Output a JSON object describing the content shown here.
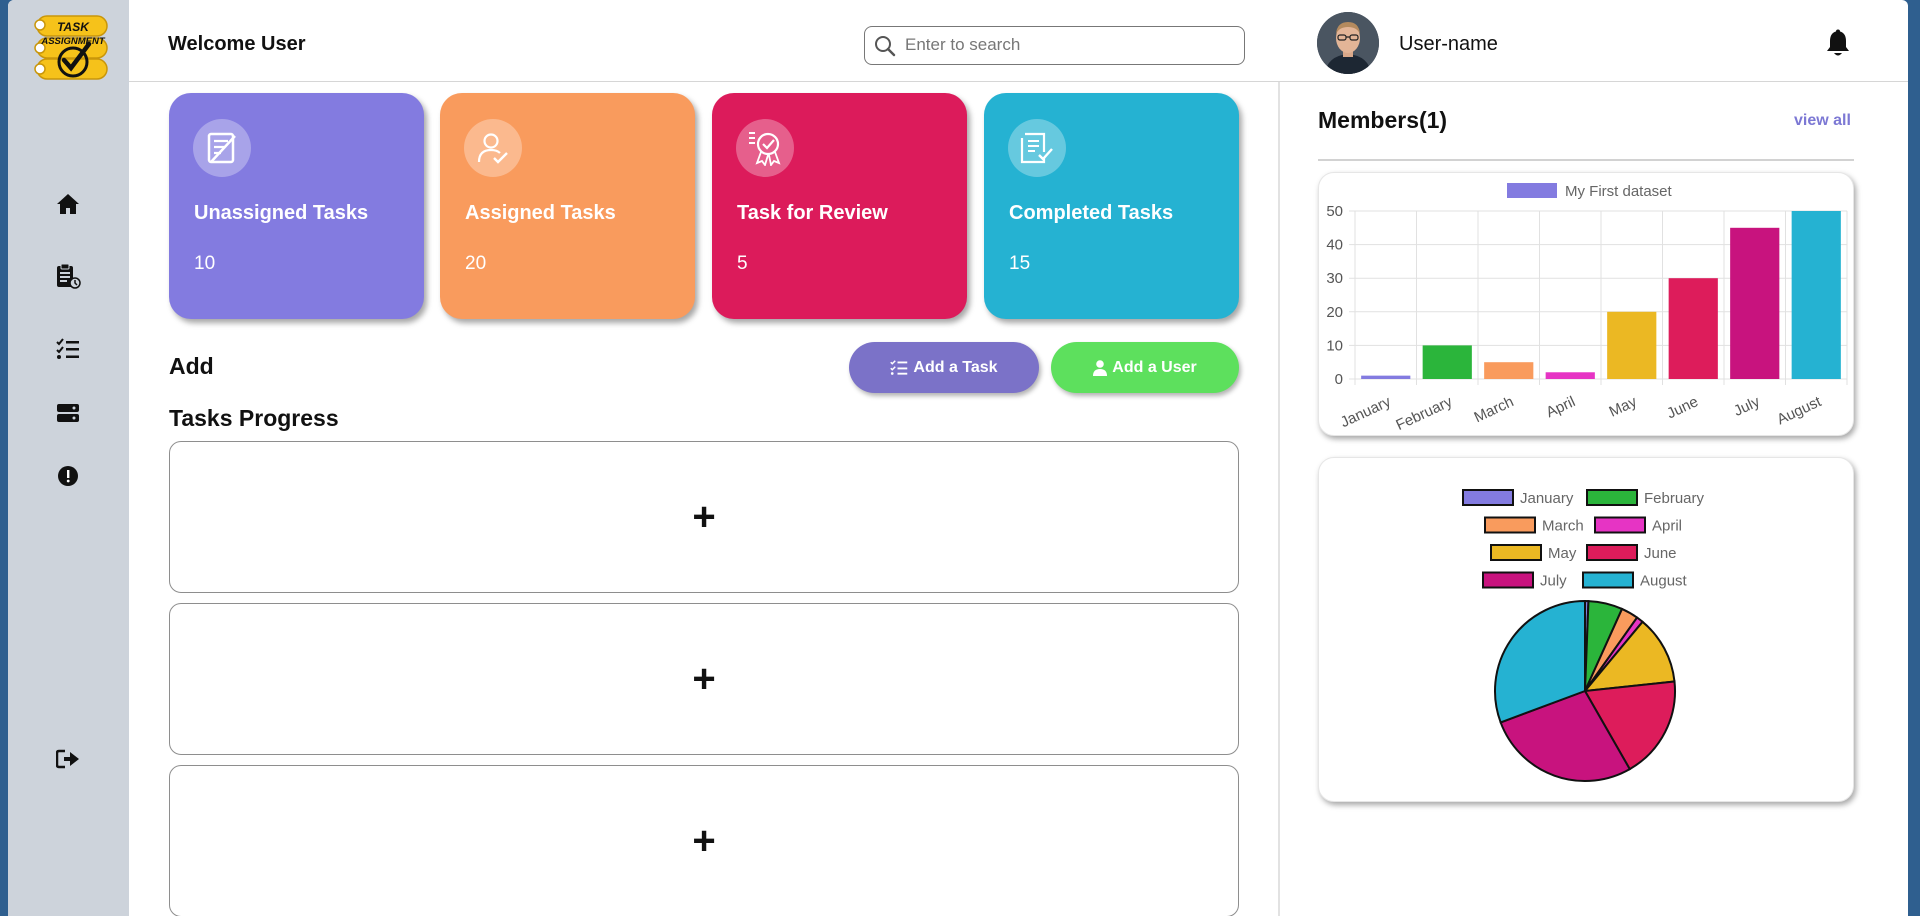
{
  "header": {
    "welcome": "Welcome User",
    "search_placeholder": "Enter to search",
    "username": "User-name"
  },
  "logo": {
    "line1": "TASK",
    "line2": "ASSIGNMENT"
  },
  "sidebar": {
    "items": [
      {
        "icon": "home-icon"
      },
      {
        "icon": "clipboard-icon"
      },
      {
        "icon": "task-list-icon"
      },
      {
        "icon": "server-icon"
      },
      {
        "icon": "alert-icon"
      },
      {
        "icon": "logout-icon"
      }
    ]
  },
  "cards": [
    {
      "title": "Unassigned Tasks",
      "count": "10",
      "color": "#837be0"
    },
    {
      "title": "Assigned Tasks",
      "count": "20",
      "color": "#f99b5d"
    },
    {
      "title": "Task for Review",
      "count": "5",
      "color": "#dc1b5b"
    },
    {
      "title": "Completed Tasks",
      "count": "15",
      "color": "#25b2d2"
    }
  ],
  "add": {
    "heading": "Add",
    "add_task_label": "Add a Task",
    "add_user_label": "Add a User"
  },
  "progress": {
    "heading": "Tasks Progress",
    "slots": [
      "+",
      "+",
      "+"
    ]
  },
  "members": {
    "title": "Members(1)",
    "view_all": "view all"
  },
  "colors": {
    "purple": "#837be0",
    "green": "#2bb53b",
    "orange": "#f99b5d",
    "magenta": "#e634c4",
    "yellow": "#ebb823",
    "red": "#dd1c5b",
    "pink": "#c8137e",
    "cyan": "#25b2d2"
  },
  "chart_data": [
    {
      "type": "bar",
      "categories": [
        "January",
        "February",
        "March",
        "April",
        "May",
        "June",
        "July",
        "August"
      ],
      "series": [
        {
          "name": "My First dataset",
          "values": [
            1,
            10,
            5,
            2,
            20,
            30,
            45,
            50
          ]
        }
      ],
      "ylim": [
        0,
        50
      ],
      "yticks": [
        0,
        10,
        20,
        30,
        40,
        50
      ],
      "grid": true,
      "legend": "top"
    },
    {
      "type": "pie",
      "labels": [
        "January",
        "February",
        "March",
        "April",
        "May",
        "June",
        "July",
        "August"
      ],
      "values": [
        1,
        10,
        5,
        2,
        20,
        30,
        45,
        50
      ],
      "legend": "top"
    }
  ]
}
